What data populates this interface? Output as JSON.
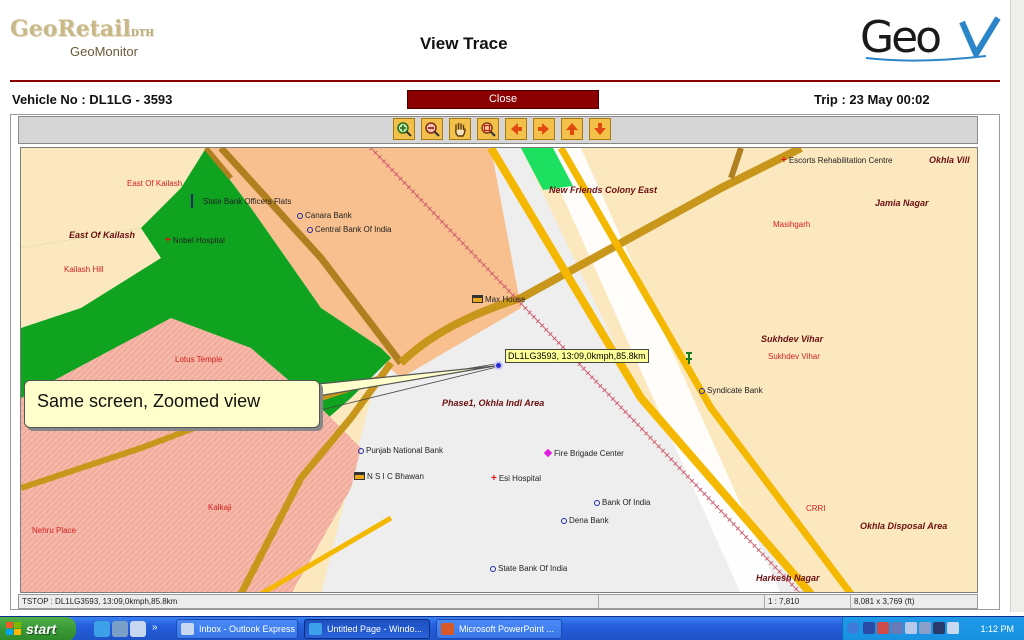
{
  "header": {
    "logo_brand": "GeoRetail",
    "logo_suffix": "DTH",
    "logo_sub": "GeoMonitor",
    "title": "View Trace",
    "logo_right": "GeoV"
  },
  "info": {
    "vehicle": "Vehicle No : DL1LG - 3593",
    "close_label": "Close",
    "trip": "Trip : 23 May 00:02"
  },
  "toolbar": {
    "tools": [
      "zoom-in",
      "zoom-out",
      "pan-hand",
      "zoom-extent",
      "pan-left",
      "pan-right",
      "pan-up",
      "pan-down"
    ]
  },
  "map": {
    "areas": {
      "east_of_kailash_top": "East Of Kailash",
      "east_of_kailash": "East Of Kailash",
      "kailash_hill": "Kailash Hill",
      "lotus_temple": "Lotus Temple",
      "kalkaji": "Kalkaji",
      "nehru_place": "Nehru Place",
      "new_friends_colony_east": "New Friends Colony East",
      "jamia_nagar": "Jamia Nagar",
      "masihgarh": "Masihgarh",
      "sukhdev_vihar_bold": "Sukhdev Vihar",
      "sukhdev_vihar": "Sukhdev Vihar",
      "phase1_okhla": "Phase1, Okhla Indl Area",
      "crri": "CRRI",
      "okhla_disposal": "Okhla Disposal Area",
      "harkesh_nagar": "Harkesh Nagar",
      "okhla_vill": "Okhla Vill"
    },
    "pois": {
      "escorts": "Escorts Rehabilitation Centre",
      "state_bank_flats": "State Bank Officers Flats",
      "canara_bank": "Canara Bank",
      "central_bank": "Central Bank Of India",
      "nobel_hospital": "Nobel Hospital",
      "max_house": "Max House",
      "syndicate_bank": "Syndicate Bank",
      "punjab_national_bank": "Punjab National Bank",
      "nsic_bhawan": "N S I C Bhawan",
      "fire_brigade": "Fire Brigade Center",
      "esi_hospital": "Esi Hospital",
      "bank_of_india": "Bank Of India",
      "dena_bank": "Dena Bank",
      "state_bank_of_india": "State Bank Of India"
    },
    "vehicle_tooltip": "DL1LG3593, 13:09,0kmph,85.8km",
    "callout": "Same screen, Zoomed view"
  },
  "statusbar": {
    "message": "TSTOP : DL1LG3593, 13:09,0kmph,85.8km",
    "scale": "1 : 7,810",
    "extent": "8,081 x 3,769 (ft)"
  },
  "taskbar": {
    "start": "start",
    "tasks": [
      "Inbox - Outlook Express",
      "Untitled Page - Windo...",
      "Microsoft PowerPoint ..."
    ],
    "clock": "1:12 PM"
  },
  "colors": {
    "accent_red": "#8b0000",
    "map_bg": "#fbe8bf",
    "park_green": "#0fa320",
    "road_gold": "#c8961a",
    "highway_yellow": "#f5b800"
  }
}
